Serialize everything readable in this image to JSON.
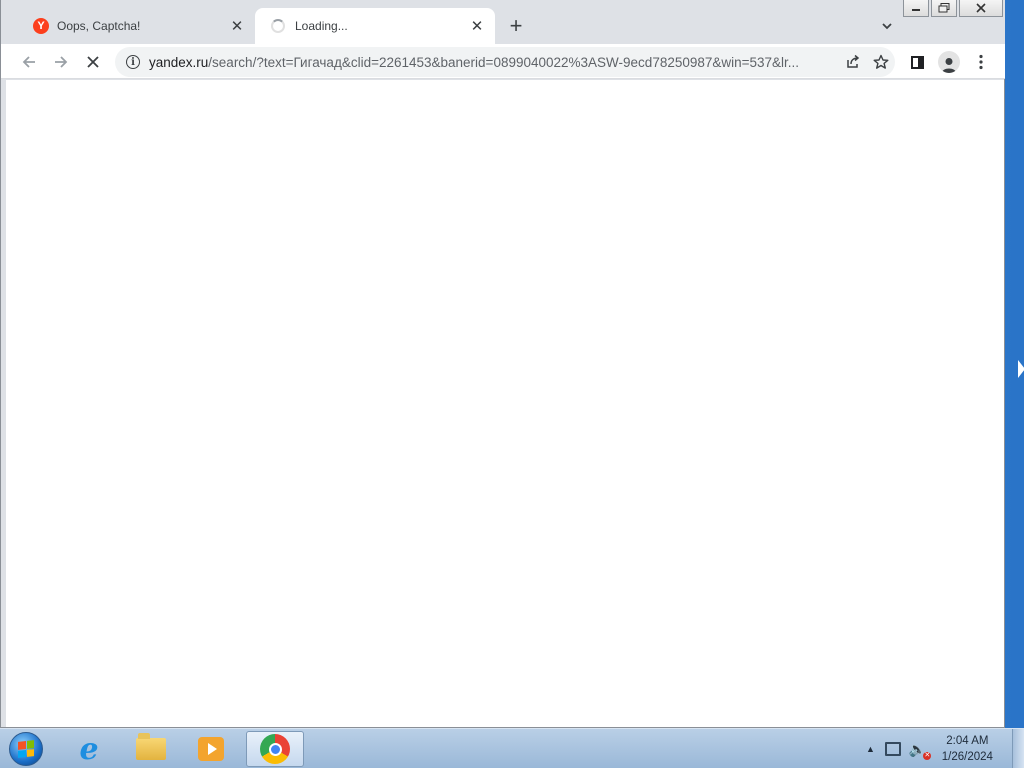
{
  "browser": {
    "tabs": [
      {
        "title": "Oops, Captcha!",
        "favicon": "yandex-favicon",
        "favicon_letter": "Y",
        "active": false
      },
      {
        "title": "Loading...",
        "favicon": "loading-spinner",
        "active": true
      }
    ],
    "new_tab_label": "+",
    "omnibox": {
      "host": "yandex.ru",
      "path": "/search/?text=Гигачад&clid=2261453&banerid=0899040022%3ASW-9ecd78250987&win=537&lr..."
    }
  },
  "taskbar": {
    "clock_time": "2:04 AM",
    "clock_date": "1/26/2024",
    "apps": [
      "internet-explorer",
      "file-explorer",
      "media-player",
      "google-chrome"
    ]
  },
  "colors": {
    "yandex_red": "#fc3f1d",
    "chrome_frame": "#dee1e6",
    "omnibox_bg": "#f1f3f4"
  }
}
